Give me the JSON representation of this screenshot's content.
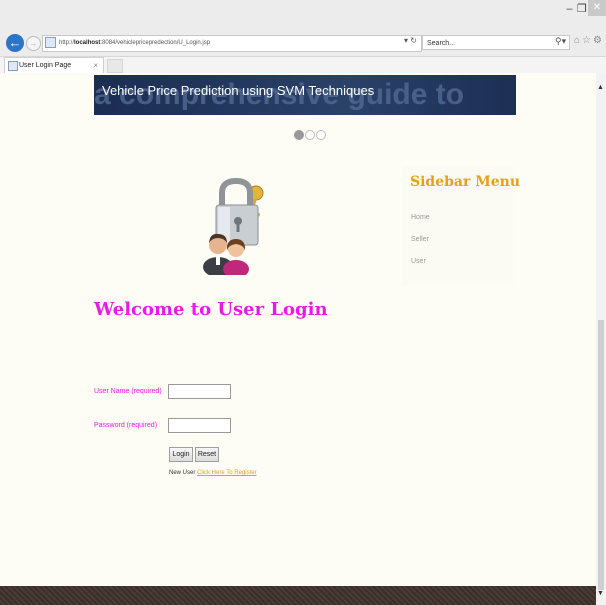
{
  "browser": {
    "window_controls": [
      "‒",
      "❐",
      "✕"
    ],
    "back_glyph": "←",
    "forward_glyph": "→",
    "url_prefix": "http://",
    "url_host": "localhost",
    "url_path": ":8084/vehiclepricepredection/U_Login.jsp",
    "refresh_glyph": "▾ ↻",
    "search_placeholder": "Search...",
    "search_glyph": "⚲▾",
    "tool_icons": "⌂☆⚙",
    "tab_title": "User Login Page",
    "tab_close": "×"
  },
  "banner": {
    "title": "Vehicle Price Prediction using SVM Techniques",
    "ghost_text": "a comprehensive guide to"
  },
  "carousel": {
    "count": 3,
    "active_index": 0
  },
  "page": {
    "welcome_heading": "Welcome to User Login"
  },
  "sidebar": {
    "title": "Sidebar Menu",
    "links": [
      "Home",
      "Seller",
      "User"
    ]
  },
  "form": {
    "username_label": "User Name (required)",
    "password_label": "Password (required)",
    "username_value": "",
    "password_value": "",
    "login_label": "Login",
    "reset_label": "Reset",
    "new_user_text": "New User ",
    "register_link": "Click Here To Register"
  },
  "scrollbar": {
    "up": "▲",
    "down": "▼"
  },
  "colors": {
    "accent_magenta": "#e81be6",
    "accent_orange": "#e6a01a",
    "banner_navy": "#1b2d52",
    "browser_blue": "#2b74c7"
  }
}
